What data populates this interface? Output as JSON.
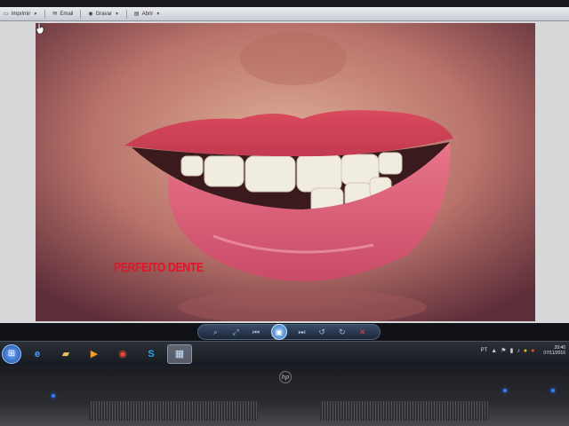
{
  "menu": {
    "items": [
      {
        "label": "Imprimir",
        "icon": "print-icon"
      },
      {
        "label": "Email",
        "icon": "email-icon"
      },
      {
        "label": "Gravar",
        "icon": "burn-icon"
      },
      {
        "label": "Abrir",
        "icon": "open-icon"
      }
    ]
  },
  "photo": {
    "overlay_text": "PERFEITO DENTE",
    "overlay_color": "#e0152a"
  },
  "controls": {
    "icons": [
      "search-zoom-icon",
      "fit-window-icon",
      "previous-icon",
      "slideshow-play-icon",
      "next-icon",
      "rotate-left-icon",
      "rotate-right-icon",
      "delete-icon"
    ]
  },
  "taskbar": {
    "language": "PT",
    "clock_time": "20:40",
    "clock_date": "07/11/2016"
  },
  "device": {
    "brand_logo": "hp"
  }
}
